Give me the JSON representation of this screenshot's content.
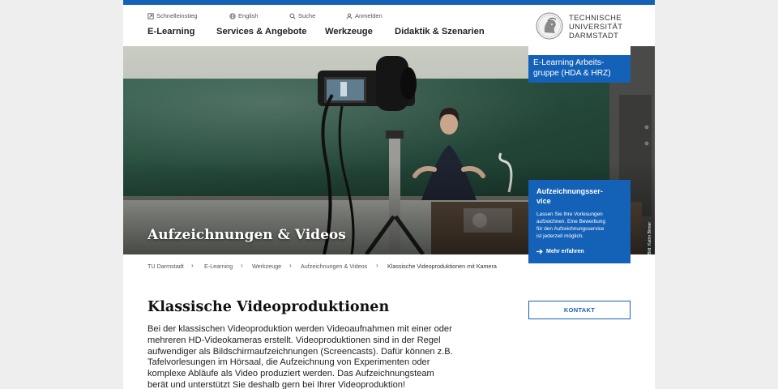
{
  "meta_nav": [
    {
      "label": "Schnelleinstieg",
      "icon": "quick-access-icon"
    },
    {
      "label": "English",
      "icon": "globe-icon"
    },
    {
      "label": "Suche",
      "icon": "search-icon"
    },
    {
      "label": "Anmelden",
      "icon": "user-icon"
    }
  ],
  "main_nav": [
    "E-Learning",
    "Services & Angebote",
    "Werkzeuge",
    "Didaktik & Szenarien"
  ],
  "logo": {
    "line1": "TECHNISCHE",
    "line2": "UNIVERSITÄT",
    "line3": "DARMSTADT"
  },
  "group_box": {
    "line1": "E-Learning Arbeits-",
    "line2": "gruppe (HDA & HRZ)"
  },
  "hero": {
    "title": "Aufzeichnungen & Videos",
    "credit": "Bild: Katrin Binner"
  },
  "service_box": {
    "title_line1": "Aufzeichnungsser-",
    "title_line2": "vice",
    "text_line1": "Lassen Sie Ihre Vorlesungen",
    "text_line2": "aufzeichnen. Eine Bewerbung",
    "text_line3": "für den Aufzeichnungsservice",
    "text_line4": "ist jederzeit möglich.",
    "link": "Mehr erfahren"
  },
  "breadcrumb": [
    "TU Darmstadt",
    "E-Learning",
    "Werkzeuge",
    "Aufzeichnungen & Videos",
    "Klassische Videoproduktionen mit Kamera"
  ],
  "content": {
    "title": "Klassische Videoproduktionen",
    "lines": [
      "Bei der klassischen Videoproduktion werden Videoaufnahmen mit einer oder",
      "mehreren HD-Videokameras erstellt. Videoproduktionen sind in der Regel",
      "aufwendiger als Bildschirmaufzeichnungen (Screencasts). Dafür können z.B.",
      "Tafelvorlesungen im Hörsaal, die Aufzeichnung von Experimenten oder",
      "komplexe Abläufe als Video produziert werden. Das Aufzeichnungsteam",
      "berät und unterstützt Sie deshalb gern bei Ihrer Videoproduktion!"
    ]
  },
  "kontakt_label": "KONTAKT",
  "colors": {
    "accent": "#1461b8",
    "background": "#eeeeee"
  }
}
